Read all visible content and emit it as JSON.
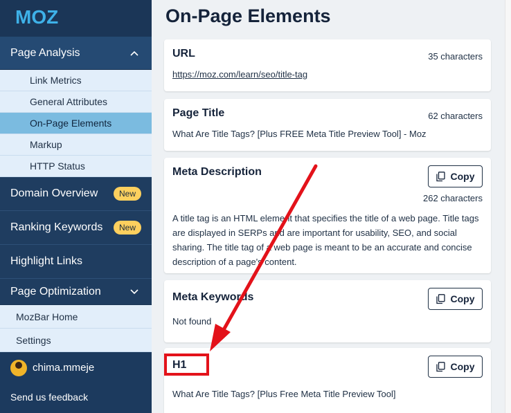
{
  "logo": {
    "text": "MOZ"
  },
  "sidebar": {
    "page_analysis": {
      "label": "Page Analysis",
      "items": [
        {
          "label": "Link Metrics"
        },
        {
          "label": "General Attributes"
        },
        {
          "label": "On-Page Elements"
        },
        {
          "label": "Markup"
        },
        {
          "label": "HTTP Status"
        }
      ]
    },
    "nav": [
      {
        "label": "Domain Overview",
        "badge": "New"
      },
      {
        "label": "Ranking Keywords",
        "badge": "New"
      },
      {
        "label": "Highlight Links"
      }
    ],
    "page_optimization": {
      "label": "Page Optimization",
      "items": [
        {
          "label": "MozBar Home"
        },
        {
          "label": "Settings"
        }
      ]
    },
    "user": {
      "name": "chima.mmeje"
    },
    "feedback": "Send us feedback"
  },
  "main": {
    "title": "On-Page Elements",
    "cards": {
      "url": {
        "title": "URL",
        "chars": "35 characters",
        "value": "https://moz.com/learn/seo/title-tag"
      },
      "page_title": {
        "title": "Page Title",
        "chars": "62 characters",
        "value": "What Are Title Tags? [Plus FREE Meta Title Preview Tool] - Moz"
      },
      "meta_description": {
        "title": "Meta Description",
        "copy": "Copy",
        "chars": "262 characters",
        "value": "A title tag is an HTML element that specifies the title of a web page. Title tags are displayed in SERPs and are important for usability, SEO, and social sharing. The title tag of a web page is meant to be an accurate and concise description of a page's content."
      },
      "meta_keywords": {
        "title": "Meta Keywords",
        "copy": "Copy",
        "value": "Not found"
      },
      "h1": {
        "title": "H1",
        "copy": "Copy",
        "value": "What Are Title Tags? [Plus Free Meta Title Preview Tool]"
      }
    }
  },
  "colors": {
    "sidebar": "#1c3a5e",
    "active_item": "#7bbbe0",
    "badge": "#fdd05e",
    "annotation": "#e3121a"
  }
}
